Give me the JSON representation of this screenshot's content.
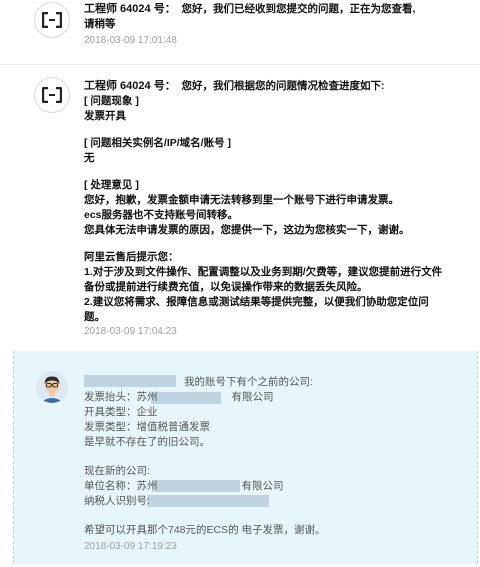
{
  "msg1": {
    "title": "工程师 64024 号：",
    "text_a": "您好，我们已经收到您提交的问题，正在为您查看,",
    "text_b": "请稍等",
    "time": "2018-03-09 17:01:48"
  },
  "msg2": {
    "title": "工程师 64024 号：",
    "intro": "您好，我们根据您的问题情况检查进度如下:",
    "h_phenomenon": "[ 问题现象 ]",
    "phenomenon": "发票开具",
    "h_instance": "[ 问题相关实例名/IP/域名/账号 ]",
    "instance": "无",
    "h_opinion": "[ 处理意见 ]",
    "opinion_1": "您好，抱歉，发票金额申请无法转移到里一个账号下进行申请发票。",
    "opinion_2": "ecs服务器也不支持账号间转移。",
    "opinion_3": "您具体无法申请发票的原因，您提供一下，这边为您核实一下，谢谢。",
    "tips_title": "阿里云售后提示您：",
    "tip_1a": "1.对于涉及到文件操作、配置调整以及业务到期/欠费等，建议您提前进行文件",
    "tip_1b": "备份或提前进行续费充值，以免误操作带来的数据丢失风险。",
    "tip_2a": "2.建议您将需求、报障信息或测试结果等提供完整，以便我们协助您定位问",
    "tip_2b": "题。",
    "time": "2018-03-09 17:04:23"
  },
  "msg3": {
    "line1": "我的账号下有个之前的公司:",
    "invoice_title_label": "发票抬头：苏州",
    "invoice_title_suffix": "有限公司",
    "invoice_type": "开具类型：企业",
    "invoice_kind": "发票类型：增值税普通发票",
    "old_company": "是早就不存在了的旧公司。",
    "new_company": "现在新的公司:",
    "unit_label": "单位名称：苏州",
    "unit_suffix": "有限公司",
    "taxid_label": "纳税人识别号:",
    "request": "希望可以开具那个748元的ECS的 电子发票，谢谢。",
    "time": "2018-03-09 17:19:23"
  },
  "colors": {
    "customer_bg": "#e6f6fb",
    "redaction": "#bfd3e1",
    "timestamp": "#a0a0a0"
  }
}
